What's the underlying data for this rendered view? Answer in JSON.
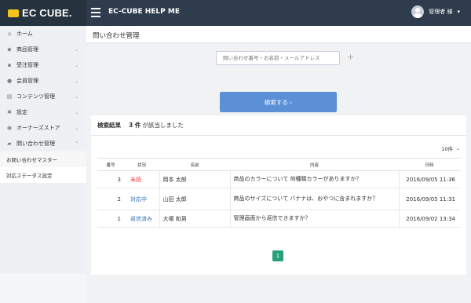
{
  "topbar": {
    "logo_text": "EC CUBE.",
    "app_title": "EC-CUBE HELP ME",
    "user_name": "管理者 様",
    "user_caret": "▾"
  },
  "sidebar": {
    "items": [
      {
        "label": "ホーム",
        "icon": "home-icon",
        "glyph": "⌂"
      },
      {
        "label": "商品管理",
        "icon": "tag-icon",
        "glyph": "◆"
      },
      {
        "label": "受注管理",
        "icon": "cart-icon",
        "glyph": "▪"
      },
      {
        "label": "会員管理",
        "icon": "users-icon",
        "glyph": "●"
      },
      {
        "label": "コンテンツ管理",
        "icon": "file-icon",
        "glyph": "▤"
      },
      {
        "label": "設定",
        "icon": "gear-icon",
        "glyph": "✱"
      },
      {
        "label": "オーナーズストア",
        "icon": "store-icon",
        "glyph": "◉"
      },
      {
        "label": "問い合わせ管理",
        "icon": "comment-icon",
        "glyph": "▰"
      }
    ],
    "sub_items": [
      {
        "label": "お問い合わせマスター"
      },
      {
        "label": "対応ステータス設定"
      }
    ]
  },
  "main": {
    "page_title": "問い合わせ管理",
    "search": {
      "placeholder": "問い合わせ番号・お名前・メールアドレス",
      "plus": "+",
      "button_label": "検索する ›"
    },
    "results": {
      "label": "検索結果",
      "count": "3 件",
      "suffix": "が該当しました",
      "per_page": "10件",
      "columns": [
        "番号",
        "状況",
        "名前",
        "内容",
        "日時"
      ],
      "rows": [
        {
          "num": "3",
          "status": "未読",
          "status_color": "#ee3333",
          "name": "岡本 太郎",
          "content": "商品のカラーについて 何種類カラーがありますか？",
          "date": "2016/09/05 11:36"
        },
        {
          "num": "2",
          "status": "対応中",
          "status_color": "#2a6db5",
          "name": "山田 太郎",
          "content": "商品のサイズについて バナナは、おやつに含まれますか？",
          "date": "2016/09/05 11:31"
        },
        {
          "num": "1",
          "status": "返信済み",
          "status_color": "#2a6db5",
          "name": "大塚 和男",
          "content": "管理画面から返信できますか？",
          "date": "2016/09/02 13:34"
        }
      ],
      "page": "1"
    }
  },
  "colors": {
    "topbar": "#2f3c4d",
    "accent_button": "#5b8fd6",
    "pager_active": "#26a17a",
    "logo_yellow": "#f3c41b"
  }
}
